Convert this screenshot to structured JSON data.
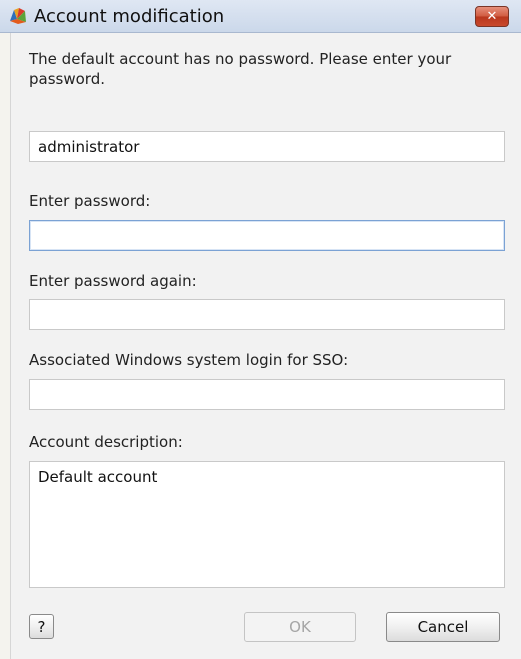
{
  "window": {
    "title": "Account modification",
    "close_glyph": "✕",
    "app_icon": "avg-logo-icon"
  },
  "form": {
    "intro": "The default account has no password. Please enter your password.",
    "username_value": "administrator",
    "password_label": "Enter password:",
    "password_value": "",
    "password_again_label": "Enter password again:",
    "password_again_value": "",
    "sso_label": "Associated Windows system login for SSO:",
    "sso_value": "",
    "description_label": "Account description:",
    "description_value": "Default account"
  },
  "buttons": {
    "help_label": "?",
    "ok_label": "OK",
    "cancel_label": "Cancel"
  },
  "colors": {
    "titlebar": "#cbd8ea",
    "close_button": "#c9492c",
    "focus_border": "#7ba2d4"
  }
}
